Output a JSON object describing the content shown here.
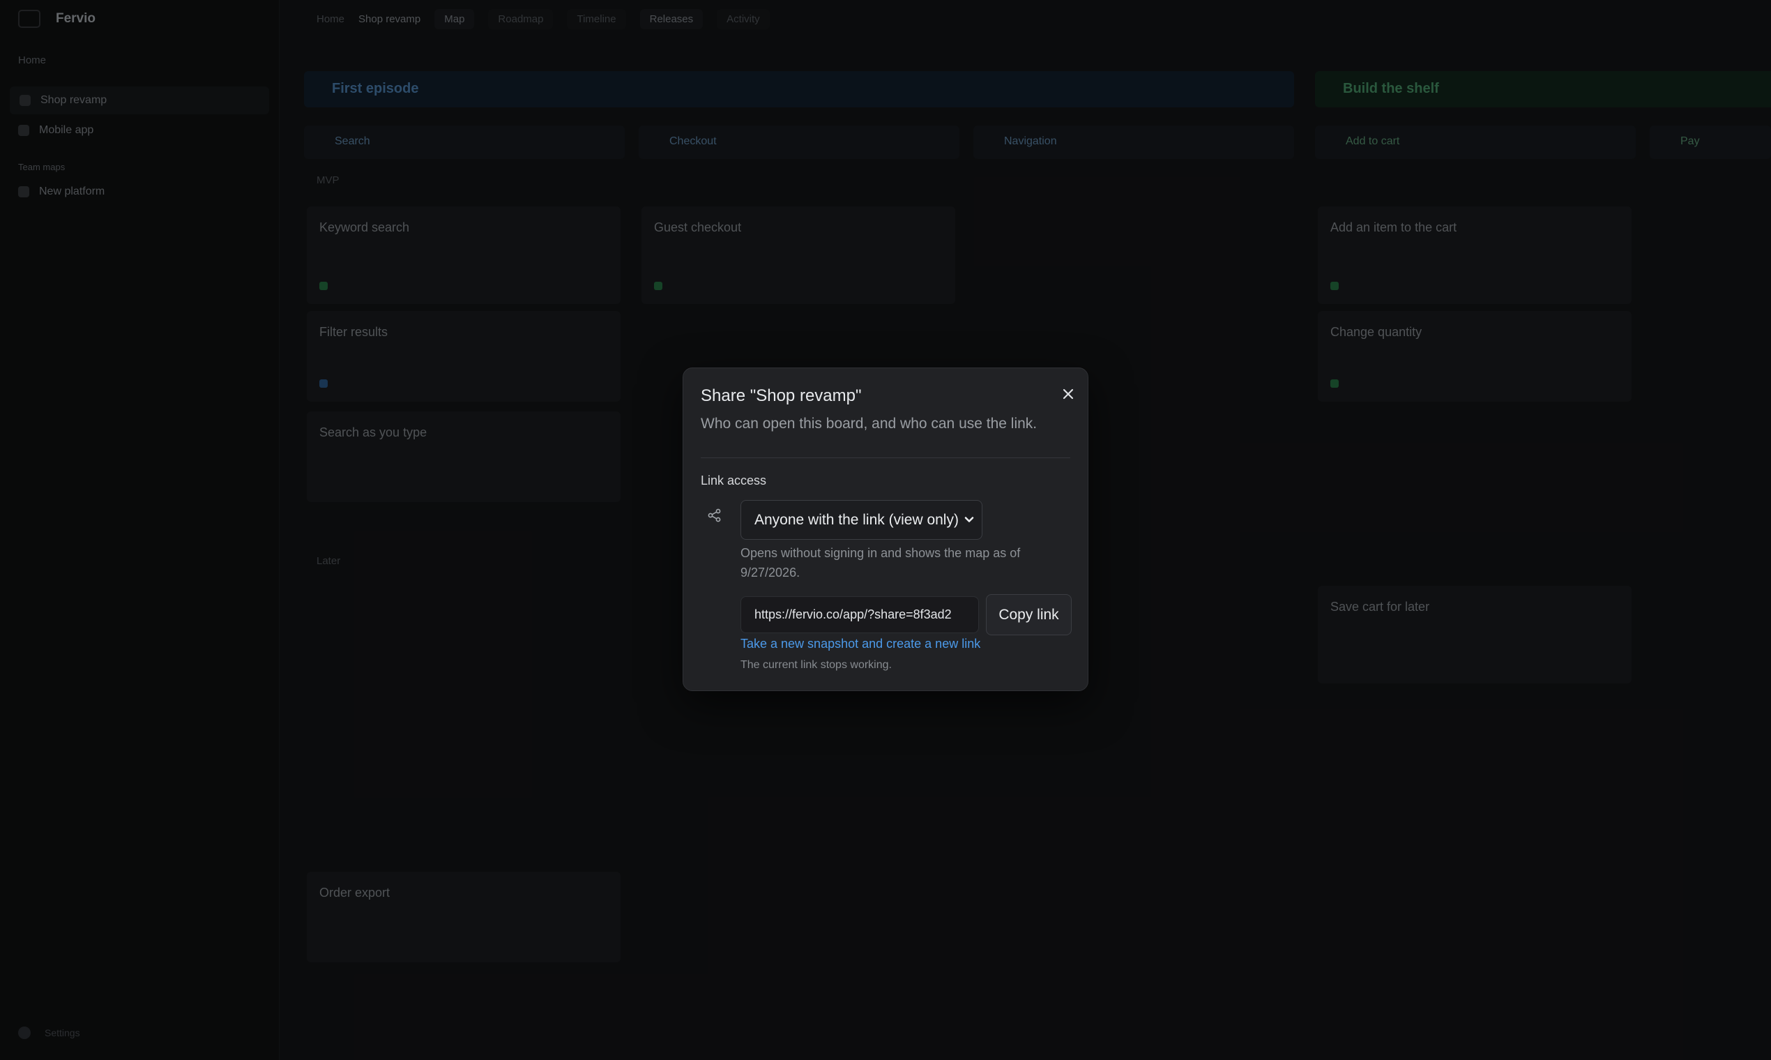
{
  "background": {
    "sidebar": {
      "brand": "Fervio",
      "section_label": "Home",
      "items": [
        {
          "label": "Shop revamp"
        },
        {
          "label": "Mobile app"
        }
      ],
      "subsection": "Team maps",
      "sub_items": [
        {
          "label": "New platform"
        }
      ],
      "footer": "Settings"
    },
    "topbar": {
      "crumbs": [
        "Home",
        "Shop revamp"
      ],
      "tabs": [
        "Map",
        "Roadmap",
        "Timeline"
      ],
      "views": [
        "Releases",
        "Activity"
      ]
    },
    "bands": [
      {
        "label": "First episode"
      },
      {
        "label": "Build the shelf"
      }
    ],
    "columns": [
      {
        "label": "Search"
      },
      {
        "label": "Checkout"
      },
      {
        "label": "Navigation"
      },
      {
        "label": "Add to cart"
      },
      {
        "label": "Pay"
      }
    ],
    "lanes": [
      "MVP",
      "Later"
    ],
    "cards": [
      {
        "title": "Keyword search"
      },
      {
        "title": "Guest checkout"
      },
      {
        "title": "Add an item to the cart"
      },
      {
        "title": "Filter results"
      },
      {
        "title": "Change quantity"
      },
      {
        "title": "Search as you type"
      },
      {
        "title": "Save cart for later"
      },
      {
        "title": "Order export"
      }
    ]
  },
  "dialog": {
    "title": "Share \"Shop revamp\"",
    "subtitle": "Who can open this board, and who can use the link.",
    "section_label": "Link access",
    "access_select": {
      "value": "Anyone with the link (view only)",
      "options": [
        "Anyone with the link (view only)"
      ]
    },
    "help_text": "Opens without signing in and shows the map as of 9/27/2026.",
    "share_url": "https://fervio.co/app/?share=8f3ad2",
    "copy_button": "Copy link",
    "regenerate_link": "Take a new snapshot and create a new link",
    "regenerate_note": "The current link stops working.",
    "icons": {
      "close": "close-icon",
      "share": "share-icon",
      "chevron": "chevron-down-icon"
    },
    "colors": {
      "link": "#4c9aea",
      "surface": "#212225",
      "backdrop": "#101112"
    }
  }
}
